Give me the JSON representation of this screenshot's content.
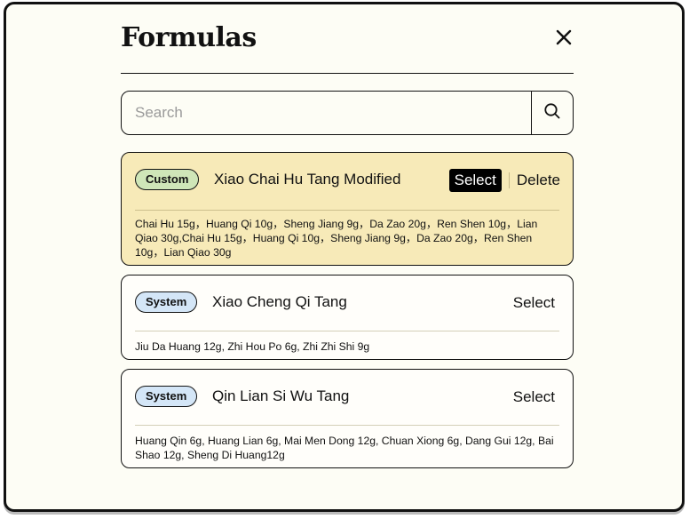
{
  "dialog": {
    "title": "Formulas",
    "close_icon": "close-icon"
  },
  "search": {
    "placeholder": "Search",
    "value": "",
    "icon": "search-icon"
  },
  "formulas": [
    {
      "badge": "Custom",
      "name": "Xiao Chai Hu Tang Modified",
      "select_label": "Select",
      "delete_label": "Delete",
      "ingredients": "Chai Hu 15g，Huang Qi 10g，Sheng Jiang 9g，Da Zao 20g，Ren Shen 10g，Lian Qiao 30g,Chai Hu 15g，Huang Qi 10g，Sheng Jiang 9g，Da Zao 20g，Ren Shen 10g，Lian Qiao 30g",
      "badge_color": "#cfe6b8",
      "card_color": "#f7eab8"
    },
    {
      "badge": "System",
      "name": "Xiao Cheng Qi Tang",
      "select_label": "Select",
      "ingredients": "Jiu Da Huang 12g, Zhi Hou Po 6g, Zhi Zhi Shi 9g",
      "badge_color": "#d4e6f7"
    },
    {
      "badge": "System",
      "name": "Qin Lian Si Wu Tang",
      "select_label": "Select",
      "ingredients": "Huang Qin 6g, Huang Lian 6g, Mai Men Dong 12g, Chuan Xiong 6g, Dang Gui 12g, Bai Shao 12g, Sheng Di Huang12g",
      "badge_color": "#d4e6f7"
    }
  ]
}
